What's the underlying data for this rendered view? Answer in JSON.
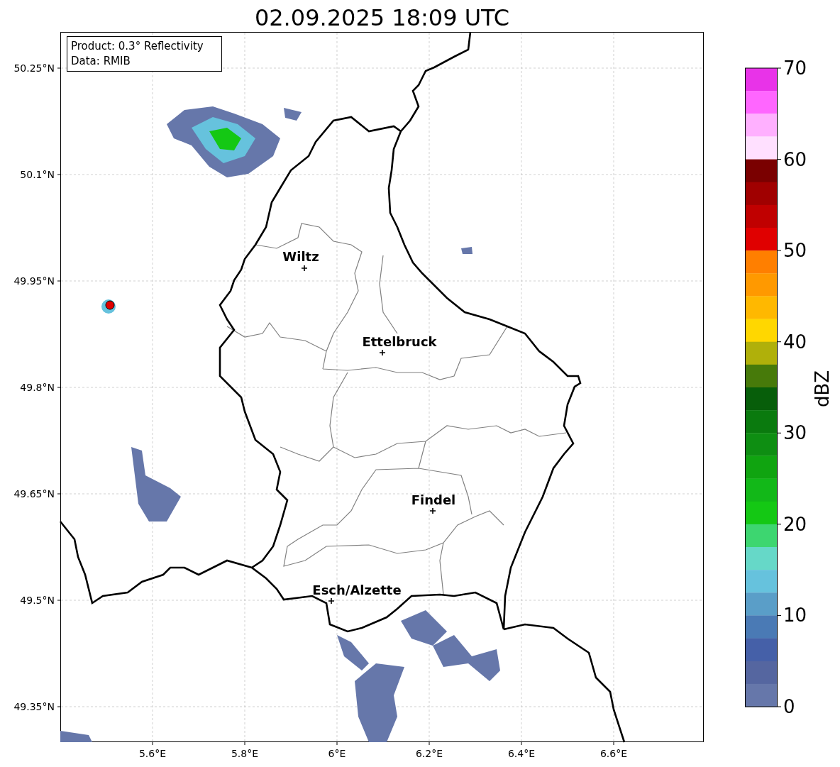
{
  "title": "02.09.2025 18:09 UTC",
  "info_box": [
    "Product: 0.3° Reflectivity",
    "Data: RMIB"
  ],
  "map": {
    "cities": [
      {
        "name": "Wiltz"
      },
      {
        "name": "Ettelbruck"
      },
      {
        "name": "Findel"
      },
      {
        "name": "Esch/Alzette"
      }
    ],
    "x_ticks": [
      "5.6°E",
      "5.8°E",
      "6°E",
      "6.2°E",
      "6.4°E",
      "6.6°E"
    ],
    "y_ticks": [
      "50.25°N",
      "50.1°N",
      "49.95°N",
      "49.8°N",
      "49.65°N",
      "49.5°N",
      "49.35°N"
    ]
  },
  "colorbar": {
    "label": "dBZ",
    "ticks": [
      "70",
      "60",
      "50",
      "40",
      "30",
      "20",
      "10",
      "0"
    ],
    "segments": [
      {
        "color": "#e833e8"
      },
      {
        "color": "#ff66ff"
      },
      {
        "color": "#ffb0ff"
      },
      {
        "color": "#ffe0ff"
      },
      {
        "color": "#7a0000"
      },
      {
        "color": "#a00000"
      },
      {
        "color": "#c00000"
      },
      {
        "color": "#e00000"
      },
      {
        "color": "#ff7f00"
      },
      {
        "color": "#ff9900"
      },
      {
        "color": "#ffb800"
      },
      {
        "color": "#ffd700"
      },
      {
        "color": "#b0b00a"
      },
      {
        "color": "#477a0a"
      },
      {
        "color": "#075e0a"
      },
      {
        "color": "#0a7a0e"
      },
      {
        "color": "#0e8e12"
      },
      {
        "color": "#10a410"
      },
      {
        "color": "#12b818"
      },
      {
        "color": "#14c814"
      },
      {
        "color": "#3dd670"
      },
      {
        "color": "#66d8c8"
      },
      {
        "color": "#66c2dd"
      },
      {
        "color": "#5a9ec8"
      },
      {
        "color": "#4a7ab5"
      },
      {
        "color": "#4560a8"
      },
      {
        "color": "#5566a0"
      },
      {
        "color": "#6677aa"
      }
    ]
  }
}
